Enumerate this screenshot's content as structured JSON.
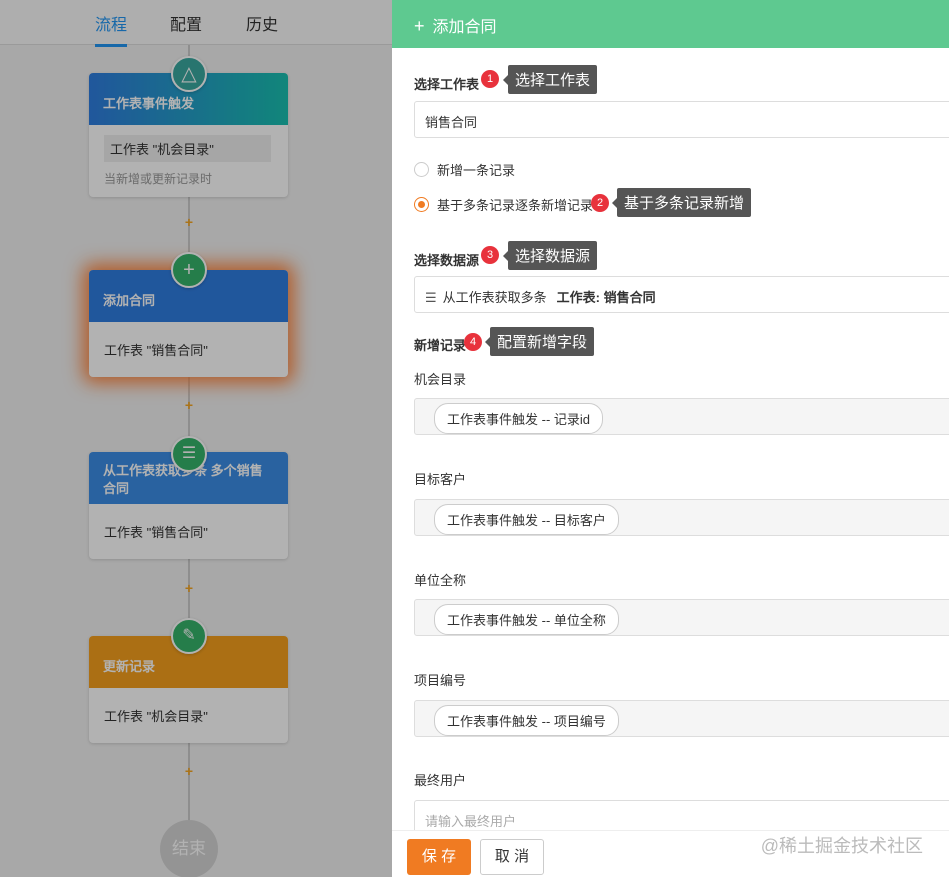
{
  "tabs": [
    "流程",
    "配置",
    "历史"
  ],
  "flow": {
    "trigger": {
      "title": "工作表事件触发",
      "sheet": "工作表 \"机会目录\"",
      "sub": "当新增或更新记录时",
      "icon": "△"
    },
    "add": {
      "title": "添加合同",
      "sheet": "工作表 \"销售合同\"",
      "icon": "+"
    },
    "fetch": {
      "title": "从工作表获取多条 多个销售合同",
      "sheet": "工作表 \"销售合同\"",
      "icon": "☰"
    },
    "update": {
      "title": "更新记录",
      "sheet": "工作表 \"机会目录\"",
      "icon": "✎"
    },
    "plus": "+",
    "end": "结束"
  },
  "panel": {
    "title": "添加合同",
    "title_icon": "+",
    "select_sheet_label": "选择工作表",
    "select_sheet_value": "销售合同",
    "radio_single": "新增一条记录",
    "radio_multi": "基于多条记录逐条新增记录",
    "select_source_label": "选择数据源",
    "source_text": "从工作表获取多条",
    "source_sheet": "工作表: 销售合同",
    "new_record_label": "新增记录",
    "fields": [
      {
        "label": "机会目录",
        "chip": "工作表事件触发 -- 记录id"
      },
      {
        "label": "目标客户",
        "chip": "工作表事件触发 -- 目标客户"
      },
      {
        "label": "单位全称",
        "chip": "工作表事件触发 -- 单位全称"
      },
      {
        "label": "项目编号",
        "chip": "工作表事件触发 -- 项目编号"
      },
      {
        "label": "最终用户",
        "placeholder": "请输入最终用户"
      }
    ],
    "save": "保 存",
    "cancel": "取 消"
  },
  "annotations": [
    {
      "num": "1",
      "text": "选择工作表"
    },
    {
      "num": "2",
      "text": "基于多条记录新增"
    },
    {
      "num": "3",
      "text": "选择数据源"
    },
    {
      "num": "4",
      "text": "配置新增字段"
    }
  ],
  "watermark": "@稀土掘金技术社区",
  "colors": {
    "header": "#5ec990",
    "accent": "#f07b22",
    "badge": "#e8323c",
    "tab_active": "#2196f3"
  }
}
